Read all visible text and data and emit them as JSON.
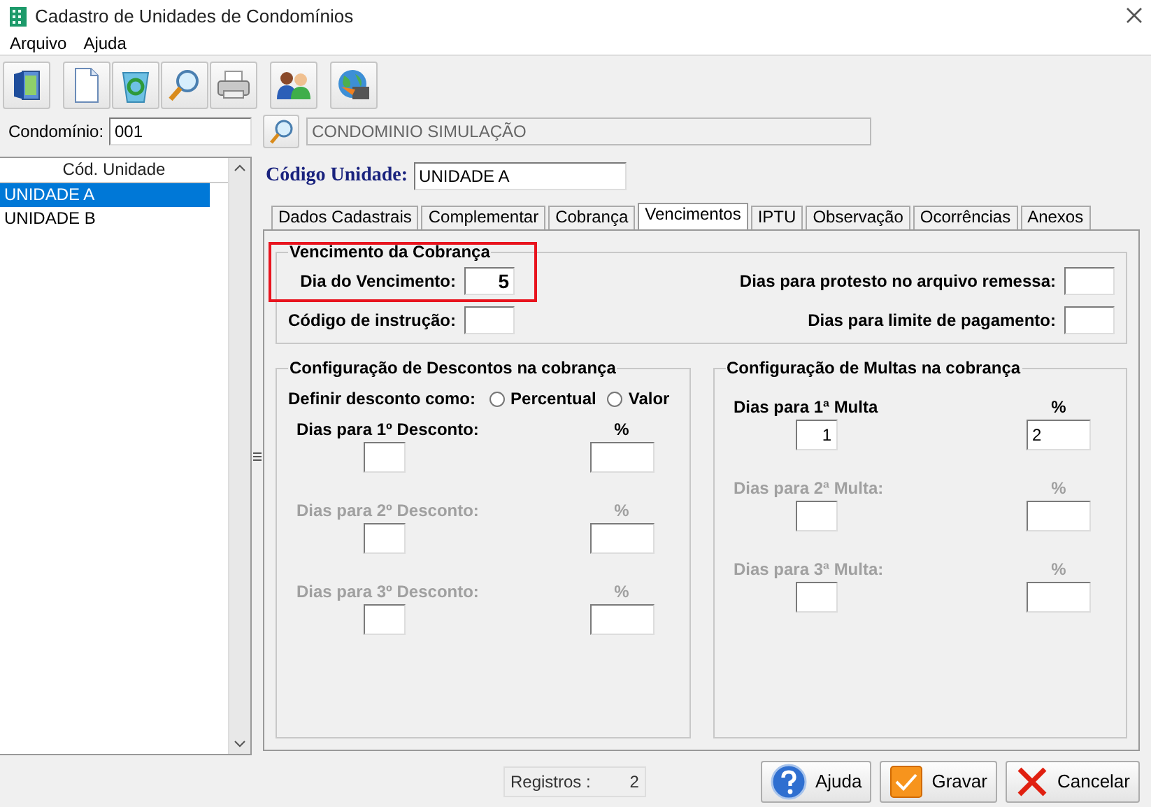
{
  "window": {
    "title": "Cadastro de Unidades de Condomínios"
  },
  "menu": [
    "Arquivo",
    "Ajuda"
  ],
  "condominio": {
    "label": "Condomínio:",
    "code": "001",
    "name": "CONDOMINIO SIMULAÇÃO"
  },
  "units": {
    "header": "Cód. Unidade",
    "items": [
      {
        "label": "UNIDADE A",
        "selected": true
      },
      {
        "label": "UNIDADE B",
        "selected": false
      }
    ]
  },
  "unit_code": {
    "label": "Código Unidade:",
    "value": "UNIDADE A"
  },
  "tabs": [
    {
      "label": "Dados Cadastrais",
      "selected": false
    },
    {
      "label": "Complementar",
      "selected": false
    },
    {
      "label": "Cobrança",
      "selected": false
    },
    {
      "label": "Vencimentos",
      "selected": true
    },
    {
      "label": "IPTU",
      "selected": false
    },
    {
      "label": "Observação",
      "selected": false
    },
    {
      "label": "Ocorrências",
      "selected": false
    },
    {
      "label": "Anexos",
      "selected": false
    }
  ],
  "vencimento": {
    "title": "Vencimento da  Cobrança",
    "highlighted": true,
    "left_fields": [
      {
        "label": "Dia do Vencimento:",
        "value": "5"
      },
      {
        "label": "Código de instrução:"
      }
    ],
    "right_fields": [
      {
        "label": "Dias para protesto no arquivo remessa:"
      },
      {
        "label": "Dias para limite de pagamento:"
      }
    ]
  },
  "descontos": {
    "title": "Configuração de Descontos na cobrança",
    "mode_label": "Definir desconto como:",
    "options": [
      {
        "label": "Percentual",
        "selected": false
      },
      {
        "label": "Valor",
        "selected": false
      }
    ],
    "rows": [
      {
        "label": "Dias para 1º Desconto:",
        "percent_label": "%",
        "disabled": false
      },
      {
        "label": "Dias para 2º Desconto:",
        "percent_label": "%",
        "disabled": true
      },
      {
        "label": "Dias para 3º Desconto:",
        "percent_label": "%",
        "disabled": true
      }
    ]
  },
  "multas": {
    "title": "Configuração de Multas na cobrança",
    "rows": [
      {
        "label": "Dias para 1ª Multa",
        "percent_label": "%",
        "days": "1",
        "percent": "2",
        "disabled": false
      },
      {
        "label": "Dias para 2ª Multa:",
        "percent_label": "%",
        "disabled": true
      },
      {
        "label": "Dias para 3ª Multa:",
        "percent_label": "%",
        "disabled": true
      }
    ]
  },
  "status": {
    "label": "Registros :",
    "count": "2"
  },
  "buttons": [
    {
      "label": "Ajuda",
      "kind": "help"
    },
    {
      "label": "Gravar",
      "kind": "save"
    },
    {
      "label": "Cancelar",
      "kind": "cancel"
    }
  ]
}
